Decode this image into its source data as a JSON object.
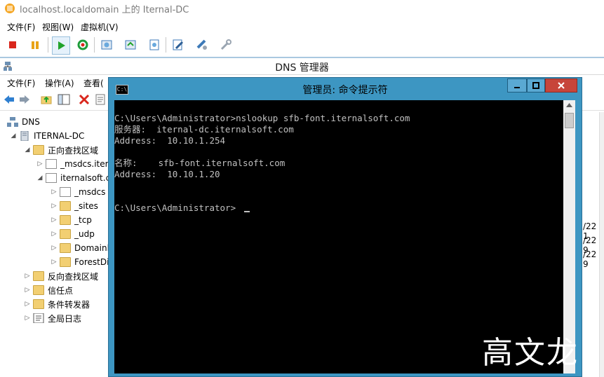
{
  "vm_window": {
    "title": "localhost.localdomain 上的 Iternal-DC",
    "menu": [
      "文件(F)",
      "视图(W)",
      "虚拟机(V)"
    ]
  },
  "dns_manager": {
    "title": "DNS 管理器",
    "menu": [
      "文件(F)",
      "操作(A)",
      "查看("
    ],
    "tree": {
      "root": "DNS",
      "server": "ITERNAL-DC",
      "forward_zones": "正向查找区域",
      "msdcs": "_msdcs.itern",
      "zone": "iternalsoft.c",
      "children": [
        "_msdcs",
        "_sites",
        "_tcp",
        "_udp",
        "Domainl",
        "ForestDi"
      ],
      "reverse_zones": "反向查找区域",
      "trust_points": "信任点",
      "conditional_forwarders": "条件转发器",
      "global_logs": "全局日志"
    },
    "right_dates": [
      "/22 1",
      "/22 9",
      "/22 9"
    ]
  },
  "cmd_window": {
    "title": "管理员: 命令提示符",
    "lines": [
      "C:\\Users\\Administrator>nslookup sfb-font.iternalsoft.com",
      "服务器:  iternal-dc.iternalsoft.com",
      "Address:  10.10.1.254",
      "",
      "名称:    sfb-font.iternalsoft.com",
      "Address:  10.10.1.20",
      "",
      "C:\\Users\\Administrator>"
    ]
  },
  "watermark": "高文龙"
}
